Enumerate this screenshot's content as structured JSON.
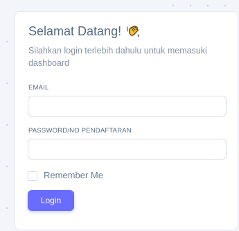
{
  "login_card": {
    "title": "Selamat Datang!",
    "title_icon": "waving-hand-icon",
    "subtitle": "Silahkan login terlebih dahulu untuk memasuki dashboard",
    "email_label": "EMAIL",
    "email_value": "",
    "password_label": "PASSWORD/NO PENDAFTARAN",
    "password_value": "",
    "remember_label": "Remember Me",
    "remember_checked": false,
    "login_label": "Login"
  },
  "colors": {
    "accent": "#696cff",
    "heading": "#566a7f",
    "muted_text": "#8592a3",
    "input_border": "#d9dee3",
    "page_background": "#f4f5fb"
  }
}
